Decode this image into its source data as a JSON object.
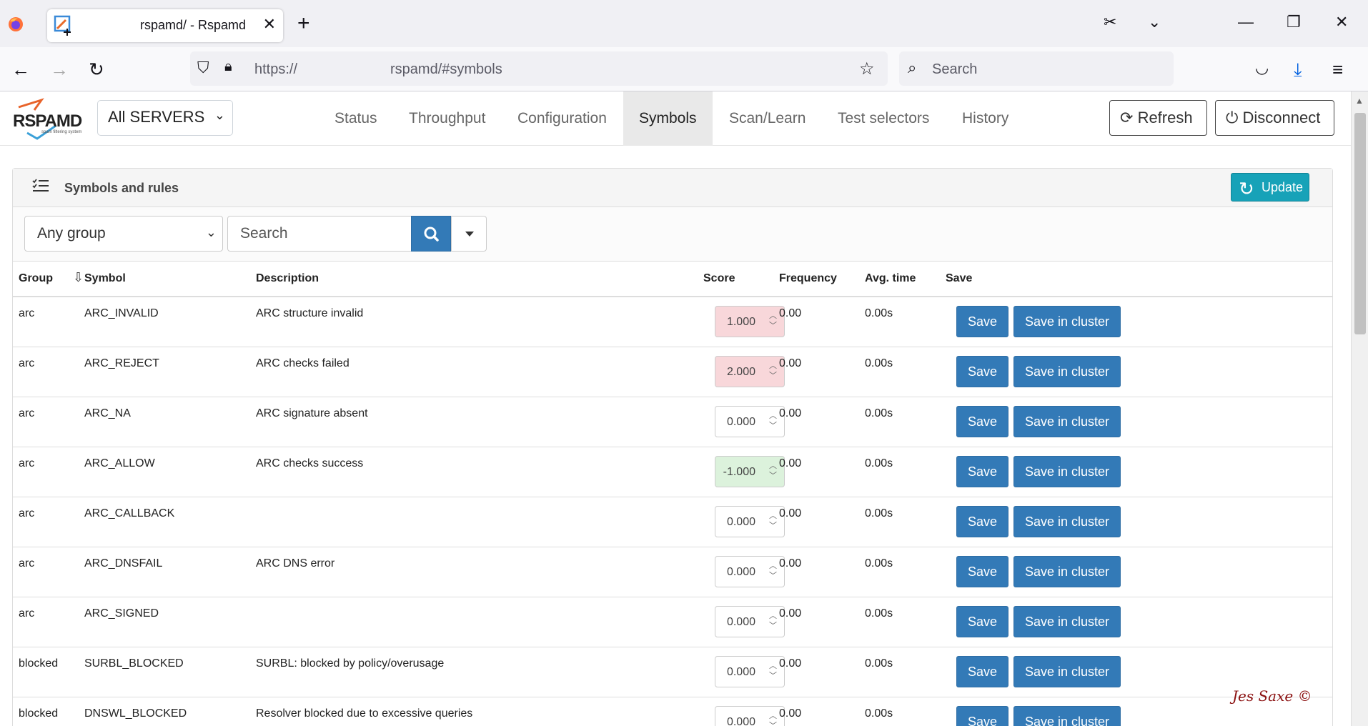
{
  "browser": {
    "tab_title": "rspamd/ - Rspamd",
    "url_scheme": "https://",
    "url_rest": "rspamd/#symbols",
    "search_placeholder": "Search"
  },
  "header": {
    "brand": "RSPAMD",
    "brand_sub": "spam filtering system",
    "server": "All SERVERS",
    "nav": [
      "Status",
      "Throughput",
      "Configuration",
      "Symbols",
      "Scan/Learn",
      "Test selectors",
      "History"
    ],
    "active_nav": "Symbols",
    "refresh_label": "Refresh",
    "disconnect_label": "Disconnect"
  },
  "card": {
    "title": "Symbols and rules",
    "update_label": "Update",
    "group_filter": "Any group",
    "search_placeholder": "Search"
  },
  "table": {
    "columns": [
      "Group",
      "Symbol",
      "Description",
      "Score",
      "Frequency",
      "Avg. time",
      "Save"
    ],
    "save_label": "Save",
    "save_cluster_label": "Save in cluster",
    "rows": [
      {
        "group": "arc",
        "symbol": "ARC_INVALID",
        "description": "ARC structure invalid",
        "score": "1.000",
        "frequency": "0.00",
        "avg_time": "0.00s"
      },
      {
        "group": "arc",
        "symbol": "ARC_REJECT",
        "description": "ARC checks failed",
        "score": "2.000",
        "frequency": "0.00",
        "avg_time": "0.00s"
      },
      {
        "group": "arc",
        "symbol": "ARC_NA",
        "description": "ARC signature absent",
        "score": "0.000",
        "frequency": "0.00",
        "avg_time": "0.00s"
      },
      {
        "group": "arc",
        "symbol": "ARC_ALLOW",
        "description": "ARC checks success",
        "score": "-1.000",
        "frequency": "0.00",
        "avg_time": "0.00s"
      },
      {
        "group": "arc",
        "symbol": "ARC_CALLBACK",
        "description": "",
        "score": "0.000",
        "frequency": "0.00",
        "avg_time": "0.00s"
      },
      {
        "group": "arc",
        "symbol": "ARC_DNSFAIL",
        "description": "ARC DNS error",
        "score": "0.000",
        "frequency": "0.00",
        "avg_time": "0.00s"
      },
      {
        "group": "arc",
        "symbol": "ARC_SIGNED",
        "description": "",
        "score": "0.000",
        "frequency": "0.00",
        "avg_time": "0.00s"
      },
      {
        "group": "blocked",
        "symbol": "SURBL_BLOCKED",
        "description": "SURBL: blocked by policy/overusage",
        "score": "0.000",
        "frequency": "0.00",
        "avg_time": "0.00s"
      },
      {
        "group": "blocked",
        "symbol": "DNSWL_BLOCKED",
        "description": "Resolver blocked due to excessive queries",
        "score": "0.000",
        "frequency": "0.00",
        "avg_time": "0.00s"
      }
    ]
  },
  "watermark": "Jes Saxe ©",
  "colors": {
    "primary": "#337ab7",
    "info": "#17a2b8",
    "positive_score": "#f8d7da",
    "negative_score": "#dcf2dc"
  }
}
